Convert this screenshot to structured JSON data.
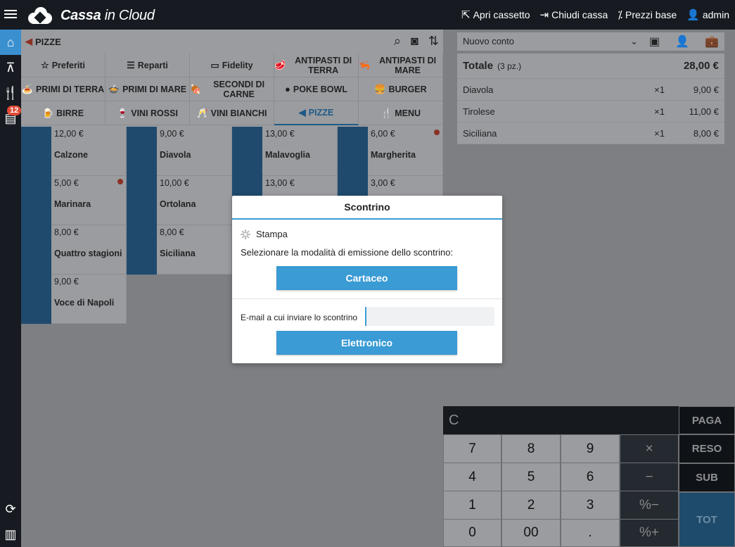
{
  "topbar": {
    "brand_bold": "Cassa",
    "brand_light": "in Cloud",
    "actions": [
      {
        "label": "Apri cassetto",
        "icon": "external-link-icon"
      },
      {
        "label": "Chiudi cassa",
        "icon": "exit-icon"
      },
      {
        "label": "Prezzi base",
        "icon": "percent-icon"
      },
      {
        "label": "admin",
        "icon": "user-icon"
      }
    ]
  },
  "sidebar": {
    "badge": "12"
  },
  "category": {
    "current": "PIZZE"
  },
  "tabs": [
    {
      "label": "Preferiti",
      "icon": "star-icon"
    },
    {
      "label": "Reparti",
      "icon": "list-icon"
    },
    {
      "label": "Fidelity",
      "icon": "card-icon"
    },
    {
      "label": "ANTIPASTI DI TERRA",
      "icon": "antipasti-terra-icon"
    },
    {
      "label": "ANTIPASTI DI MARE",
      "icon": "antipasti-mare-icon"
    },
    {
      "label": "PRIMI DI TERRA",
      "icon": "primi-terra-icon"
    },
    {
      "label": "PRIMI DI MARE",
      "icon": "primi-mare-icon"
    },
    {
      "label": "SECONDI DI CARNE",
      "icon": "secondi-carne-icon"
    },
    {
      "label": "POKE BOWL",
      "icon": "poke-bowl-icon"
    },
    {
      "label": "BURGER",
      "icon": "burger-icon"
    },
    {
      "label": "BIRRE",
      "icon": "beer-icon"
    },
    {
      "label": "VINI ROSSI",
      "icon": "red-wine-icon"
    },
    {
      "label": "VINI BIANCHI",
      "icon": "white-wine-icon"
    },
    {
      "label": "PIZZE",
      "icon": "pizza-icon"
    },
    {
      "label": "MENU",
      "icon": "cutlery-icon"
    }
  ],
  "products": [
    {
      "price": "12,00 €",
      "name": "Calzone"
    },
    {
      "price": "9,00 €",
      "name": "Diavola"
    },
    {
      "price": "13,00 €",
      "name": "Malavoglia"
    },
    {
      "price": "6,00 €",
      "name": "Margherita"
    },
    {
      "price": "5,00 €",
      "name": "Marinara"
    },
    {
      "price": "10,00 €",
      "name": "Ortolana"
    },
    {
      "price": "13,00 €",
      "name": ""
    },
    {
      "price": "3,00 €",
      "name": ""
    },
    {
      "price": "8,00 €",
      "name": "Quattro stagioni"
    },
    {
      "price": "8,00 €",
      "name": "Siciliana"
    },
    {
      "price": "9,00 €",
      "name": "Voce di Napoli"
    }
  ],
  "account": {
    "selector": "Nuovo conto",
    "total_label": "Totale",
    "total_count": "(3 pz.)",
    "total_value": "28,00 €",
    "items": [
      {
        "name": "Diavola",
        "qty": "×1",
        "price": "9,00 €"
      },
      {
        "name": "Tirolese",
        "qty": "×1",
        "price": "11,00 €"
      },
      {
        "name": "Siciliana",
        "qty": "×1",
        "price": "8,00 €"
      }
    ]
  },
  "keypad": {
    "display": "C",
    "paga": "PAGA",
    "reso": "RESO",
    "sub": "SUB",
    "tot": "TOT",
    "keys": [
      "7",
      "8",
      "9",
      "×",
      "4",
      "5",
      "6",
      "−",
      "1",
      "2",
      "3",
      "%−",
      "0",
      "00",
      ".",
      "%+"
    ]
  },
  "modal": {
    "title": "Scontrino",
    "status": "Stampa",
    "instruction": "Selezionare la modalità di emissione dello scontrino:",
    "paper_button": "Cartaceo",
    "email_label": "E-mail a cui inviare lo scontrino",
    "email_value": "",
    "electronic_button": "Elettronico"
  }
}
